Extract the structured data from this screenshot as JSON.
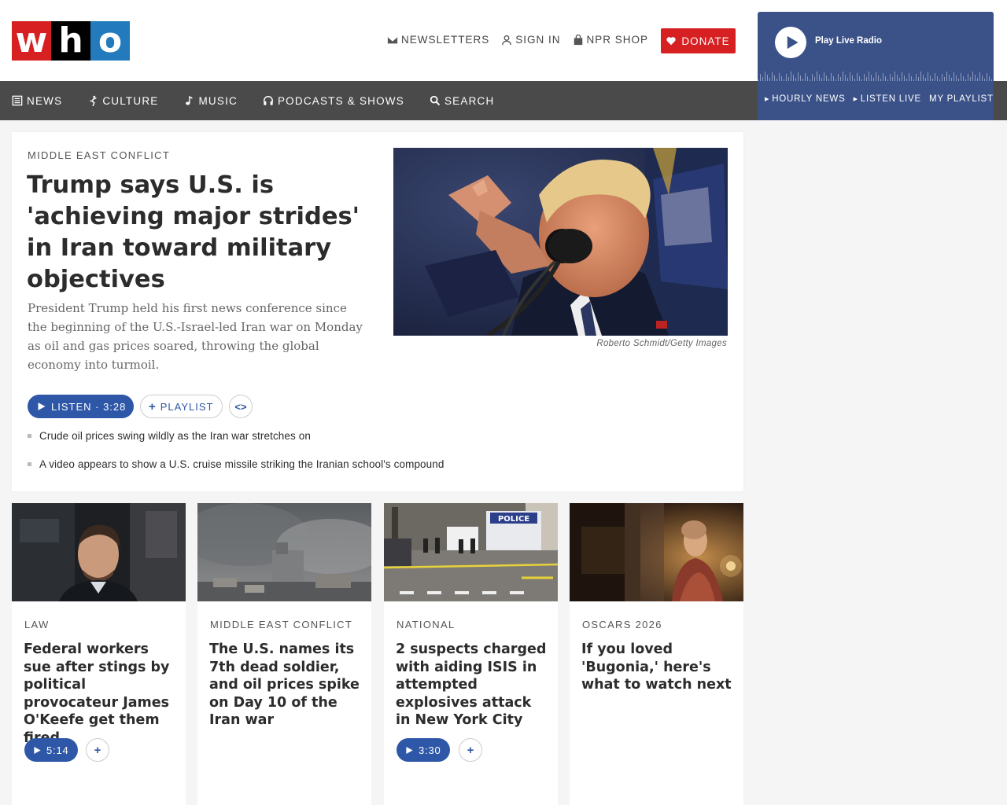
{
  "logo": {
    "letters": [
      "w",
      "h",
      "o"
    ]
  },
  "header": {
    "links": [
      {
        "label": "NEWSLETTERS",
        "icon": "envelope-icon"
      },
      {
        "label": "SIGN IN",
        "icon": "user-icon"
      },
      {
        "label": "NPR SHOP",
        "icon": "shopping-bag-icon"
      }
    ],
    "donate_label": "DONATE"
  },
  "player": {
    "play_label": "Play Live Radio",
    "links": [
      "HOURLY NEWS",
      "LISTEN LIVE",
      "MY PLAYLIST"
    ]
  },
  "nav": {
    "items": [
      {
        "label": "NEWS",
        "icon": "news-icon"
      },
      {
        "label": "CULTURE",
        "icon": "culture-icon"
      },
      {
        "label": "MUSIC",
        "icon": "music-note-icon"
      },
      {
        "label": "PODCASTS & SHOWS",
        "icon": "headphones-icon"
      },
      {
        "label": "SEARCH",
        "icon": "search-icon"
      }
    ]
  },
  "lead": {
    "kicker": "MIDDLE EAST CONFLICT",
    "headline": "Trump says U.S. is 'achieving major strides' in Iran toward military objectives",
    "teaser": "President Trump held his first news conference since the beginning of the U.S.-Israel-led Iran war on Monday as oil and gas prices soared, throwing the global economy into turmoil.",
    "credit": "Roberto Schmidt/Getty Images",
    "listen_label": "LISTEN · 3:28",
    "playlist_label": "PLAYLIST",
    "embed_label": "<>",
    "related": [
      "Crude oil prices swing wildly as the Iran war stretches on",
      "A video appears to show a U.S. cruise missile striking the Iranian school's compound"
    ]
  },
  "stories": [
    {
      "kicker": "LAW",
      "title": "Federal workers sue after stings by political provocateur James O'Keefe get them fired",
      "audio": "5:14"
    },
    {
      "kicker": "MIDDLE EAST CONFLICT",
      "title": "The U.S. names its 7th dead soldier, and oil prices spike on Day 10 of the Iran war",
      "audio": null
    },
    {
      "kicker": "NATIONAL",
      "title": "2 suspects charged with aiding ISIS in attempted explosives attack in New York City",
      "audio": "3:30"
    },
    {
      "kicker": "OSCARS 2026",
      "title": "If you loved 'Bugonia,' here's what to watch next",
      "audio": null
    }
  ],
  "colors": {
    "brand_red": "#d62021",
    "brand_blue": "#237bbd",
    "player_blue": "#3b5288",
    "button_blue": "#2e57a7",
    "nav_gray": "#4a4a4a"
  }
}
